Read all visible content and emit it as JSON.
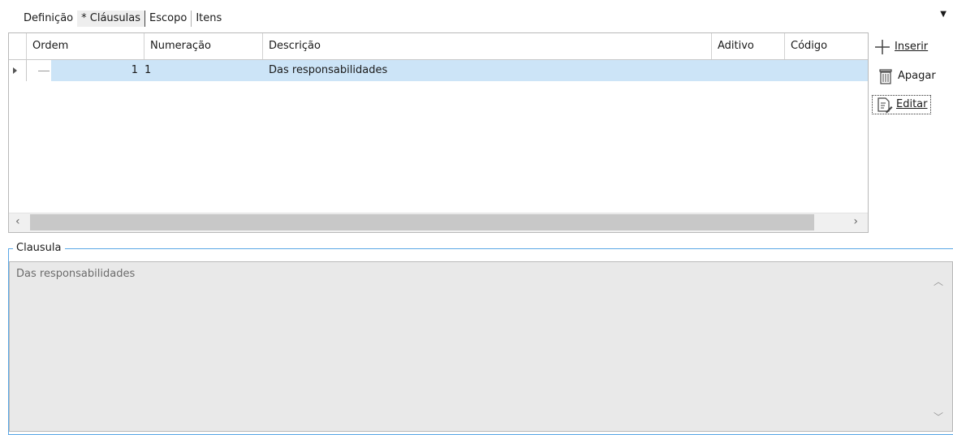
{
  "tabs": [
    {
      "label": "Definição"
    },
    {
      "label": "* Cláusulas"
    },
    {
      "label": "Escopo"
    },
    {
      "label": "Itens"
    }
  ],
  "grid": {
    "columns": [
      "Ordem",
      "Numeração",
      "Descrição",
      "Aditivo",
      "Código"
    ],
    "rows": [
      {
        "ordem": "1",
        "numeracao": "1",
        "descricao": "Das responsabilidades",
        "aditivo": "",
        "codigo": ""
      }
    ]
  },
  "actions": {
    "insert_label": "Inserir",
    "delete_label": "Apagar",
    "edit_label": "Editar"
  },
  "clause": {
    "title": "Clausula",
    "text": "Das responsabilidades"
  },
  "colors": {
    "selected_row": "#cce4f7",
    "group_border": "#5aa7e6",
    "textarea_bg": "#e9e9e9"
  }
}
